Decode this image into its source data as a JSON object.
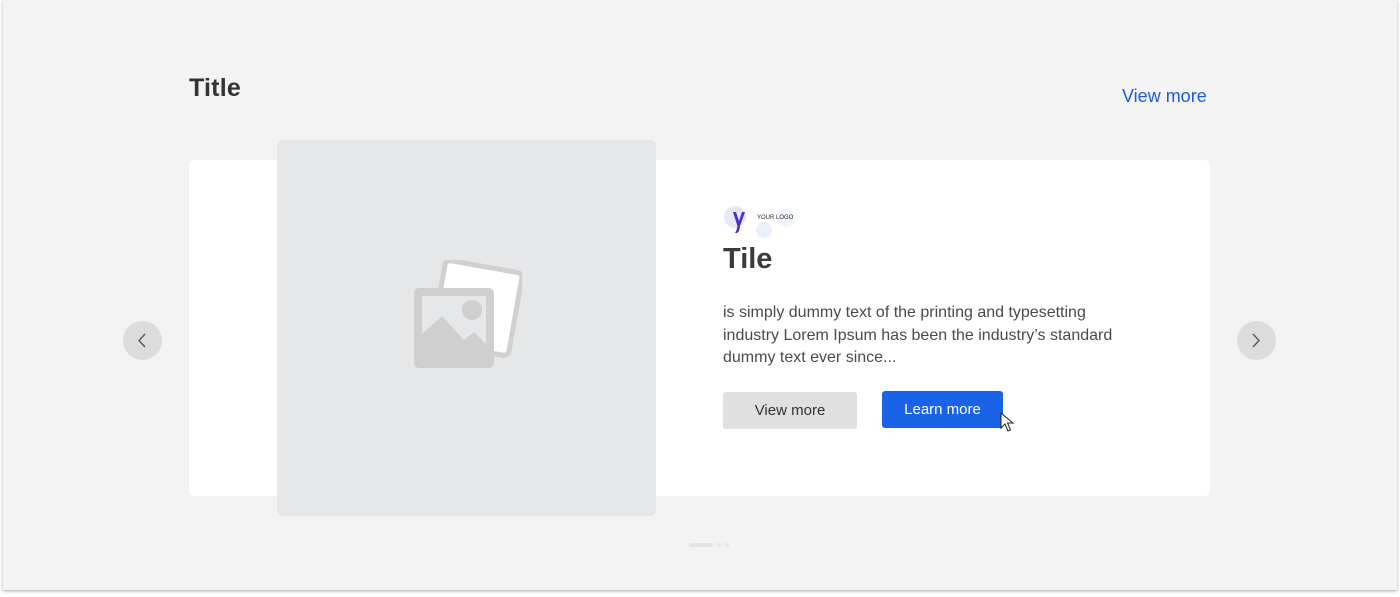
{
  "section": {
    "title": "Title",
    "view_more_label": "View more"
  },
  "card": {
    "logo_text": "YOUR LOGO",
    "tile_title": "Tile",
    "description": "is simply dummy text of the printing and typesetting industry Lorem Ipsum has been the industry’s standard  dummy  text  ever  since...",
    "secondary_button_label": "View more",
    "primary_button_label": "Learn more"
  },
  "carousel": {
    "prev_icon": "chevron-left-icon",
    "next_icon": "chevron-right-icon",
    "page_count": 3,
    "active_page": 1
  },
  "colors": {
    "accent": "#1b63e6",
    "link": "#1f5bd6",
    "background": "#f3f3f3",
    "card": "#ffffff",
    "placeholder": "#e6e7e9"
  }
}
